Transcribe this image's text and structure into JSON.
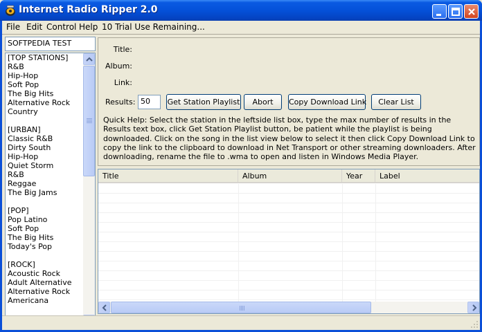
{
  "window": {
    "title": "Internet Radio Ripper 2.0",
    "controls": [
      "minimize-icon",
      "maximize-icon",
      "close-icon"
    ],
    "accent_color": "#0451d9"
  },
  "menu": {
    "items": [
      "File",
      "Edit",
      "Control",
      "Help",
      "10 Trial Use Remaining..."
    ]
  },
  "station_input": {
    "value": "SOFTPEDIA TEST"
  },
  "stations": [
    "[TOP STATIONS]",
    "R&B",
    "Hip-Hop",
    "Soft Pop",
    "The Big Hits",
    "Alternative Rock",
    "Country",
    "",
    "[URBAN]",
    "Classic R&B",
    "Dirty South",
    "Hip-Hop",
    "Quiet Storm",
    "R&B",
    "Reggae",
    "The Big Jams",
    "",
    "[POP]",
    "Pop Latino",
    "Soft Pop",
    "The Big Hits",
    "Today's Pop",
    "",
    "[ROCK]",
    "Acoustic Rock",
    "Adult Alternative",
    "Alternative Rock",
    "Americana"
  ],
  "form": {
    "title_label": "Title:",
    "album_label": "Album:",
    "link_label": "Link:",
    "results_label": "Results:",
    "results_value": "50",
    "buttons": {
      "get_playlist": "Get Station Playlist",
      "abort": "Abort",
      "copy_link": "Copy Download Link",
      "clear_list": "Clear List"
    },
    "help_text": "Quick Help: Select the station in the leftside list box, type the max number of results in the Results text box, click Get Station Playlist button, be patient while the playlist is being downloaded. Click on the song in the list view  below to select it then click Copy Download Link to  copy the link to the clipboard to download  in Net Transport or other streaming downloaders. After downloading, rename the file to .wma to open and listen in Windows Media Player."
  },
  "listview": {
    "columns": [
      "Title",
      "Album",
      "Year",
      "Label"
    ]
  }
}
